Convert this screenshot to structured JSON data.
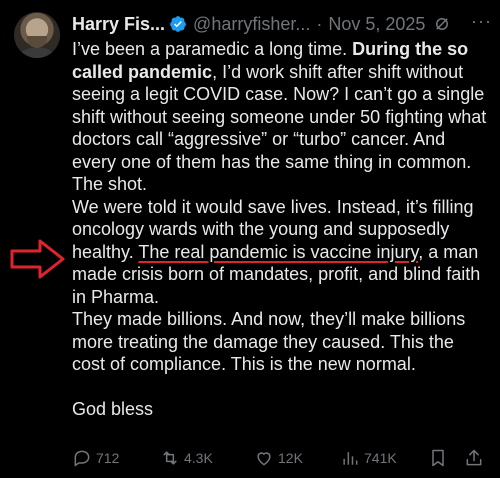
{
  "colors": {
    "background": "#000000",
    "text": "#e7e9ea",
    "secondary": "#71767b",
    "verified_badge": "#1d9bf0",
    "annotation_red": "#e0242c"
  },
  "author": {
    "display_name": "Harry Fis...",
    "handle": "@harryfisher...",
    "separator": "·",
    "date": "Nov 5, 2025",
    "verified_icon": "verified-badge-icon",
    "grok_icon": "grok-icon",
    "more_label": "···"
  },
  "tweet": {
    "p1_a": "I’ve been a paramedic a long time. ",
    "p1_bold": "During the so called pandemic",
    "p1_b": ", I’d work shift after shift without seeing a legit COVID case. Now? I can’t go a single shift without seeing someone under 50 fighting what doctors call “aggressive” or “turbo” cancer. And every one of them has the same thing in common. The shot.",
    "p2_a": "We were told it would save lives. Instead, it’s filling oncology wards with the young and supposedly healthy. ",
    "p2_underlined": "The real pandemic is vaccine injury",
    "p2_b": ", a man made crisis born of mandates, profit, and blind faith in Pharma.",
    "p3": "They made billions. And now, they’ll make billions more treating the damage they caused. This the cost of compliance. This is the new normal.",
    "p4": "God bless"
  },
  "actions": {
    "reply": {
      "icon": "reply-icon",
      "count": "712"
    },
    "retweet": {
      "icon": "retweet-icon",
      "count": "4.3K"
    },
    "like": {
      "icon": "heart-icon",
      "count": "12K"
    },
    "views": {
      "icon": "views-chart-icon",
      "count": "741K"
    },
    "bookmark": {
      "icon": "bookmark-icon"
    },
    "share": {
      "icon": "share-icon"
    }
  },
  "annotation": {
    "arrow_icon": "red-arrow-icon"
  }
}
